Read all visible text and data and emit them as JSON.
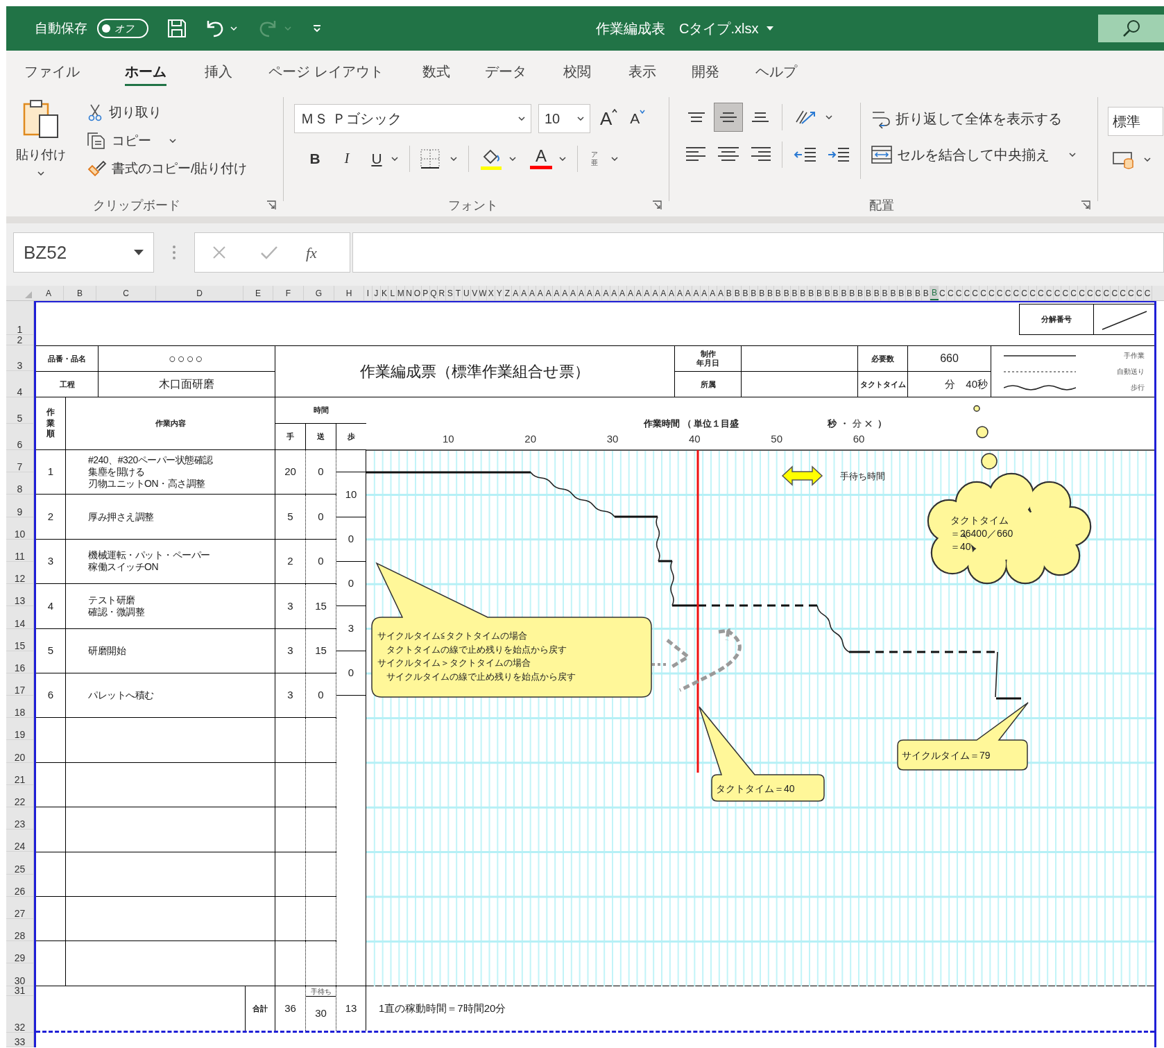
{
  "title_bar": {
    "autosave_label": "自動保存",
    "autosave": {
      "label": "オフ",
      "on": false
    },
    "redo_disabled": true,
    "title": "作業編成表　Cタイプ.xlsx"
  },
  "tabs": [
    {
      "label": "ファイル",
      "selected": false
    },
    {
      "label": "ホーム",
      "selected": true
    },
    {
      "label": "挿入",
      "selected": false
    },
    {
      "label": "ページ レイアウト",
      "selected": false
    },
    {
      "label": "数式",
      "selected": false
    },
    {
      "label": "データ",
      "selected": false
    },
    {
      "label": "校閲",
      "selected": false
    },
    {
      "label": "表示",
      "selected": false
    },
    {
      "label": "開発",
      "selected": false
    },
    {
      "label": "ヘルプ",
      "selected": false
    }
  ],
  "ribbon": {
    "clipboard": {
      "paste": "貼り付け",
      "cut": "切り取り",
      "copy": "コピー",
      "format_painter": "書式のコピー/貼り付け",
      "label": "クリップボード"
    },
    "font": {
      "font_name": "ＭＳ Ｐゴシック",
      "font_size": "10",
      "grow": "A",
      "shrink": "A",
      "bold": "B",
      "italic": "I",
      "underline": "U",
      "font_color": "A",
      "phonetic": "ア亜",
      "label": "フォント"
    },
    "alignment": {
      "vertical": [
        {
          "kind": "top",
          "selected": false
        },
        {
          "kind": "middle",
          "selected": true
        },
        {
          "kind": "bottom",
          "selected": false
        }
      ],
      "wrap_text": "折り返して全体を表示する",
      "merge_center": "セルを結合して中央揃え",
      "label": "配置"
    },
    "number": {
      "format": "標準"
    }
  },
  "formula_bar": {
    "name_box": "BZ52",
    "function_button": "fx"
  },
  "column_headers": [
    {
      "label": "A",
      "selected": false
    },
    {
      "label": "B",
      "selected": false
    },
    {
      "label": "C",
      "selected": false
    },
    {
      "label": "D",
      "selected": false
    },
    {
      "label": "E",
      "selected": false
    },
    {
      "label": "F",
      "selected": false
    },
    {
      "label": "G",
      "selected": false
    },
    {
      "label": "H",
      "selected": false
    },
    {
      "label": "I",
      "selected": false
    },
    {
      "label": "J",
      "selected": false
    },
    {
      "label": "K",
      "selected": false
    },
    {
      "label": "L",
      "selected": false
    },
    {
      "label": "M",
      "selected": false
    },
    {
      "label": "N",
      "selected": false
    },
    {
      "label": "O",
      "selected": false
    },
    {
      "label": "P",
      "selected": false
    },
    {
      "label": "Q",
      "selected": false
    },
    {
      "label": "R",
      "selected": false
    },
    {
      "label": "S",
      "selected": false
    },
    {
      "label": "T",
      "selected": false
    },
    {
      "label": "U",
      "selected": false
    },
    {
      "label": "V",
      "selected": false
    },
    {
      "label": "W",
      "selected": false
    },
    {
      "label": "X",
      "selected": false
    },
    {
      "label": "Y",
      "selected": false
    },
    {
      "label": "Z",
      "selected": false
    },
    {
      "label": "A",
      "selected": false
    },
    {
      "label": "A",
      "selected": false
    },
    {
      "label": "A",
      "selected": false
    },
    {
      "label": "A",
      "selected": false
    },
    {
      "label": "A",
      "selected": false
    },
    {
      "label": "A",
      "selected": false
    },
    {
      "label": "A",
      "selected": false
    },
    {
      "label": "A",
      "selected": false
    },
    {
      "label": "A",
      "selected": false
    },
    {
      "label": "A",
      "selected": false
    },
    {
      "label": "A",
      "selected": false
    },
    {
      "label": "A",
      "selected": false
    },
    {
      "label": "A",
      "selected": false
    },
    {
      "label": "A",
      "selected": false
    },
    {
      "label": "A",
      "selected": false
    },
    {
      "label": "A",
      "selected": false
    },
    {
      "label": "A",
      "selected": false
    },
    {
      "label": "A",
      "selected": false
    },
    {
      "label": "A",
      "selected": false
    },
    {
      "label": "A",
      "selected": false
    },
    {
      "label": "A",
      "selected": false
    },
    {
      "label": "A",
      "selected": false
    },
    {
      "label": "A",
      "selected": false
    },
    {
      "label": "A",
      "selected": false
    },
    {
      "label": "A",
      "selected": false
    },
    {
      "label": "A",
      "selected": false
    },
    {
      "label": "B",
      "selected": false
    },
    {
      "label": "B",
      "selected": false
    },
    {
      "label": "B",
      "selected": false
    },
    {
      "label": "B",
      "selected": false
    },
    {
      "label": "B",
      "selected": false
    },
    {
      "label": "B",
      "selected": false
    },
    {
      "label": "B",
      "selected": false
    },
    {
      "label": "B",
      "selected": false
    },
    {
      "label": "B",
      "selected": false
    },
    {
      "label": "B",
      "selected": false
    },
    {
      "label": "B",
      "selected": false
    },
    {
      "label": "B",
      "selected": false
    },
    {
      "label": "B",
      "selected": false
    },
    {
      "label": "B",
      "selected": false
    },
    {
      "label": "B",
      "selected": false
    },
    {
      "label": "B",
      "selected": false
    },
    {
      "label": "B",
      "selected": false
    },
    {
      "label": "B",
      "selected": false
    },
    {
      "label": "B",
      "selected": false
    },
    {
      "label": "B",
      "selected": false
    },
    {
      "label": "B",
      "selected": false
    },
    {
      "label": "B",
      "selected": false
    },
    {
      "label": "B",
      "selected": false
    },
    {
      "label": "B",
      "selected": false
    },
    {
      "label": "B",
      "selected": false
    },
    {
      "label": "B",
      "selected": true
    },
    {
      "label": "C",
      "selected": false
    },
    {
      "label": "C",
      "selected": false
    },
    {
      "label": "C",
      "selected": false
    },
    {
      "label": "C",
      "selected": false
    },
    {
      "label": "C",
      "selected": false
    },
    {
      "label": "C",
      "selected": false
    },
    {
      "label": "C",
      "selected": false
    },
    {
      "label": "C",
      "selected": false
    },
    {
      "label": "C",
      "selected": false
    },
    {
      "label": "C",
      "selected": false
    },
    {
      "label": "C",
      "selected": false
    },
    {
      "label": "C",
      "selected": false
    },
    {
      "label": "C",
      "selected": false
    },
    {
      "label": "C",
      "selected": false
    },
    {
      "label": "C",
      "selected": false
    },
    {
      "label": "C",
      "selected": false
    },
    {
      "label": "C",
      "selected": false
    },
    {
      "label": "C",
      "selected": false
    },
    {
      "label": "C",
      "selected": false
    },
    {
      "label": "C",
      "selected": false
    },
    {
      "label": "C",
      "selected": false
    },
    {
      "label": "C",
      "selected": false
    },
    {
      "label": "C",
      "selected": false
    },
    {
      "label": "C",
      "selected": false
    },
    {
      "label": "C",
      "selected": false
    },
    {
      "label": "C",
      "selected": false
    }
  ],
  "row_headers": [
    "1",
    "2",
    "3",
    "4",
    "5",
    "6",
    "7",
    "8",
    "9",
    "10",
    "11",
    "12",
    "13",
    "14",
    "15",
    "16",
    "17",
    "18",
    "19",
    "20",
    "21",
    "22",
    "23",
    "24",
    "25",
    "26",
    "27",
    "28",
    "29",
    "30",
    "31",
    "32",
    "33"
  ],
  "sheet": {
    "breakdown_label": "分解番号",
    "info": {
      "product_label": "品番・品名",
      "product": "○○○○",
      "process_label": "工程",
      "process": "木口面研磨",
      "title": "作業編成票（標準作業組合せ票）",
      "date_label": [
        "制作",
        "年月日"
      ],
      "dept_label": "所属",
      "required_label": "必要数",
      "required": "660",
      "takt_label": "タクトタイム",
      "takt": "分　40秒"
    },
    "legend": [
      {
        "kind": "solid",
        "label": "手作業"
      },
      {
        "kind": "dotted",
        "label": "自動送り"
      },
      {
        "kind": "wavy",
        "label": "歩行"
      }
    ],
    "columns": {
      "order": "作業順",
      "content": "作業内容",
      "time": "時間",
      "manual": "手",
      "auto": "送",
      "walk": "歩"
    },
    "steps": [
      {
        "no": "1",
        "content": [
          "#240、#320ペーパー状態確認",
          "集塵を開ける",
          "刃物ユニットON・高さ調整"
        ],
        "manual": "20",
        "auto": "0"
      },
      {
        "no": "2",
        "content": [
          "厚み押さえ調整"
        ],
        "manual": "5",
        "auto": "0"
      },
      {
        "no": "3",
        "content": [
          "機械運転・パット・ペーパー",
          "稼働スイッチON"
        ],
        "manual": "2",
        "auto": "0"
      },
      {
        "no": "4",
        "content": [
          "テスト研磨",
          "確認・微調整"
        ],
        "manual": "3",
        "auto": "15"
      },
      {
        "no": "5",
        "content": [
          "研磨開始"
        ],
        "manual": "3",
        "auto": "15"
      },
      {
        "no": "6",
        "content": [
          "パレットへ積む"
        ],
        "manual": "3",
        "auto": "0"
      }
    ],
    "walk_times": [
      "10",
      "0",
      "0",
      "3",
      "0"
    ],
    "chart": {
      "title": "作業時間 （ 単位１目盛",
      "unit_options": [
        {
          "label": "秒",
          "struck": false
        },
        {
          "label": "分",
          "struck": true
        }
      ],
      "unit_separator": "・",
      "unit_close": "）",
      "axis_labels": [
        "10",
        "20",
        "30",
        "40",
        "50",
        "60"
      ],
      "wait_label": "手待ち時間",
      "cloud_text": [
        "タクトタイム",
        "＝26400／660",
        "＝40"
      ],
      "callout": [
        "サイクルタイム≦タクトタイムの場合",
        "　タクトタイムの線で止め残りを始点から戻す",
        "サイクルタイム＞タクトタイムの場合",
        "　サイクルタイムの線で止め残りを始点から戻す"
      ],
      "takt_callout": "タクトタイム＝40",
      "cycle_callout": "サイクルタイム＝79"
    },
    "totals": {
      "label": "合計",
      "manual": "36",
      "wait_label": "手待ち",
      "auto": "30",
      "walk": "13",
      "note": "1直の稼動時間＝7時間20分"
    }
  }
}
